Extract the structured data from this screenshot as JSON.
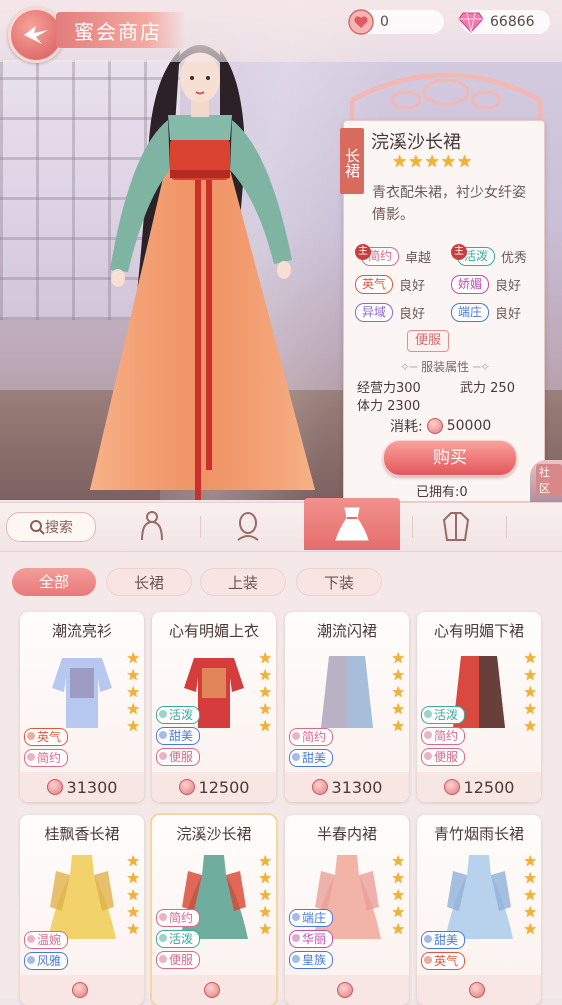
{
  "header": {
    "title": "蜜会商店",
    "currency_hearts": "0",
    "currency_diamonds": "66866"
  },
  "detail": {
    "category": "长裙",
    "name": "浣溪沙长裙",
    "stars": 5,
    "description": "青衣配朱裙，衬少女纤姿倩影。",
    "attributes": [
      {
        "label": "简约",
        "grade": "卓越",
        "main": true,
        "color": "#d86a8a"
      },
      {
        "label": "活泼",
        "grade": "优秀",
        "main": true,
        "color": "#3aa89a"
      },
      {
        "label": "英气",
        "grade": "良好",
        "main": false,
        "color": "#e0573f"
      },
      {
        "label": "娇媚",
        "grade": "良好",
        "main": false,
        "color": "#c04fb0"
      },
      {
        "label": "异域",
        "grade": "良好",
        "main": false,
        "color": "#8a6ad6"
      },
      {
        "label": "端庄",
        "grade": "良好",
        "main": false,
        "color": "#4a7ad6"
      }
    ],
    "main_marker": "主",
    "casual_badge": "便服",
    "section_title": "服装属性",
    "stat_camp": "经营力",
    "stat_camp_value": "300",
    "stat_force": "武力",
    "stat_force_value": "250",
    "stat_stamina": "体力",
    "stat_stamina_value": "2300",
    "cost_label": "消耗:",
    "cost_value": "50000",
    "buy_label": "购买",
    "owned": "已拥有:0",
    "community": "社区"
  },
  "tabs": {
    "search_label": "搜索"
  },
  "filters": [
    "全部",
    "长裙",
    "上装",
    "下装"
  ],
  "items": [
    {
      "name": "潮流亮衫",
      "tags": [
        {
          "t": "英气",
          "c": "#e0573f"
        },
        {
          "t": "简约",
          "c": "#d86a8a"
        }
      ],
      "price": "31300",
      "stars": 5
    },
    {
      "name": "心有明媚上衣",
      "tags": [
        {
          "t": "活泼",
          "c": "#3aa89a"
        },
        {
          "t": "甜美",
          "c": "#4a7ad6"
        },
        {
          "t": "便服",
          "c": "#d86a8a"
        }
      ],
      "price": "12500",
      "stars": 5
    },
    {
      "name": "潮流闪裙",
      "tags": [
        {
          "t": "简约",
          "c": "#d86a8a"
        },
        {
          "t": "甜美",
          "c": "#4a7ad6"
        }
      ],
      "price": "31300",
      "stars": 5
    },
    {
      "name": "心有明媚下裙",
      "tags": [
        {
          "t": "活泼",
          "c": "#3aa89a"
        },
        {
          "t": "简约",
          "c": "#d86a8a"
        },
        {
          "t": "便服",
          "c": "#d86a8a"
        }
      ],
      "price": "12500",
      "stars": 5
    },
    {
      "name": "桂飘香长裙",
      "tags": [
        {
          "t": "温婉",
          "c": "#d86a8a"
        },
        {
          "t": "风雅",
          "c": "#4a7ad6"
        }
      ],
      "price": "",
      "stars": 5
    },
    {
      "name": "浣溪沙长裙",
      "tags": [
        {
          "t": "简约",
          "c": "#d86a8a"
        },
        {
          "t": "活泼",
          "c": "#3aa89a"
        },
        {
          "t": "便服",
          "c": "#d86a8a"
        }
      ],
      "price": "",
      "stars": 5
    },
    {
      "name": "半春内裙",
      "tags": [
        {
          "t": "端庄",
          "c": "#4a7ad6"
        },
        {
          "t": "华丽",
          "c": "#c04fb0"
        },
        {
          "t": "皇族",
          "c": "#4a7ad6"
        }
      ],
      "price": "",
      "stars": 5
    },
    {
      "name": "青竹烟雨长裙",
      "tags": [
        {
          "t": "甜美",
          "c": "#4a7ad6"
        },
        {
          "t": "英气",
          "c": "#e0573f"
        }
      ],
      "price": "",
      "stars": 5
    }
  ]
}
